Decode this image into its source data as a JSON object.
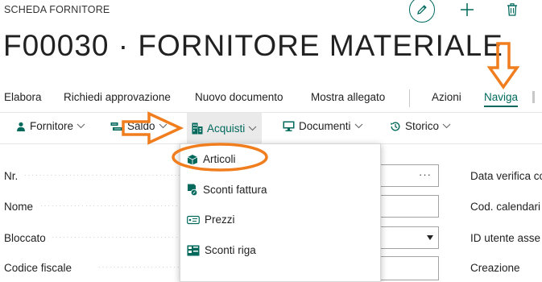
{
  "header": {
    "caption": "SCHEDA FORNITORE",
    "title": "F00030 · FORNITORE MATERIALE"
  },
  "actions": {
    "elabora": "Elabora",
    "richiedi": "Richiedi approvazione",
    "nuovo": "Nuovo documento",
    "mostra": "Mostra allegato",
    "azioni": "Azioni",
    "naviga": "Naviga"
  },
  "subnav": {
    "fornitore": "Fornitore",
    "saldo": "Saldo",
    "acquisti": "Acquisti",
    "documenti": "Documenti",
    "storico": "Storico"
  },
  "form": {
    "nr": "Nr.",
    "nome": "Nome",
    "bloccato": "Bloccato",
    "codice_fiscale": "Codice fiscale",
    "nr_assist": "···"
  },
  "right_fields": {
    "data_verifica": "Data verifica co",
    "cod_calendario": "Cod. calendari",
    "id_utente": "ID utente asse",
    "creazione": "Creazione"
  },
  "menu": {
    "articoli": "Articoli",
    "sconti_fattura": "Sconti fattura",
    "prezzi": "Prezzi",
    "sconti_riga": "Sconti riga"
  },
  "colors": {
    "accent": "#00695c",
    "annotation": "#f07d1e"
  }
}
